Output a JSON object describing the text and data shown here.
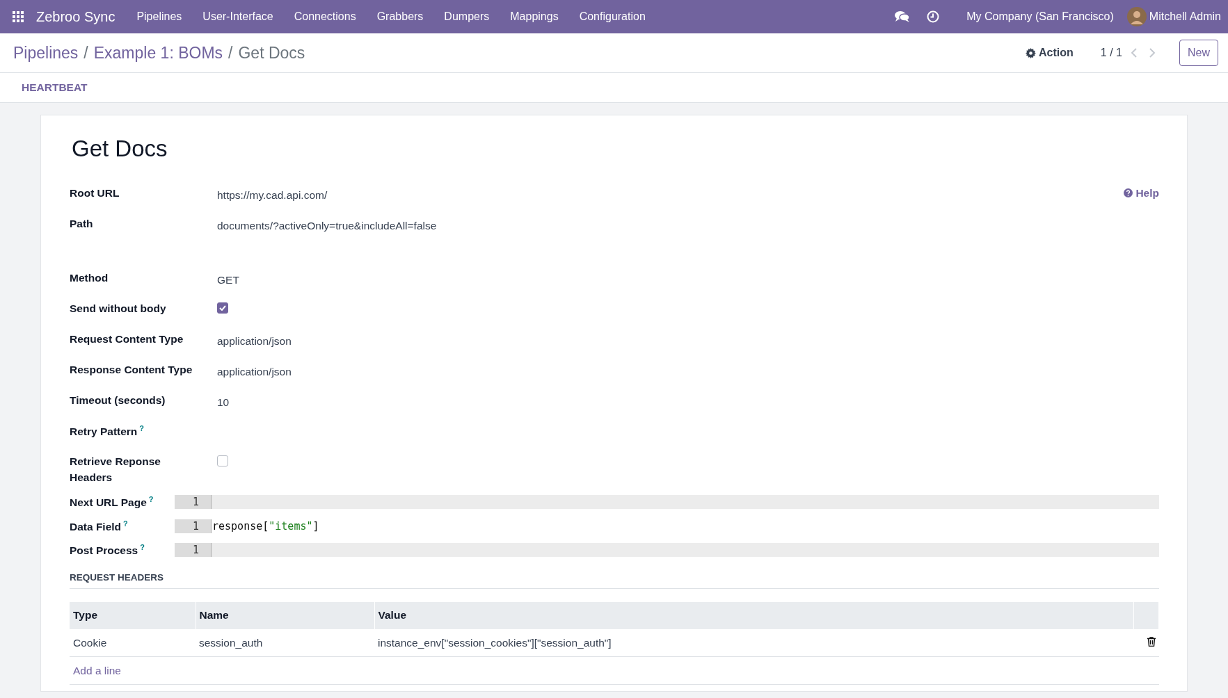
{
  "navbar": {
    "app_name": "Zebroo Sync",
    "menu": [
      "Pipelines",
      "User-Interface",
      "Connections",
      "Grabbers",
      "Dumpers",
      "Mappings",
      "Configuration"
    ],
    "company": "My Company (San Francisco)",
    "user": "Mitchell Admin"
  },
  "breadcrumb": [
    {
      "kind": "link",
      "label": "Pipelines"
    },
    {
      "kind": "separator",
      "label": "/"
    },
    {
      "kind": "link",
      "label": "Example 1: BOMs"
    },
    {
      "kind": "separator",
      "label": "/"
    },
    {
      "kind": "current",
      "label": "Get Docs"
    }
  ],
  "control_panel": {
    "action": "Action",
    "pager": "1 / 1",
    "new_button": "New"
  },
  "button_box": [
    "HEARTBEAT"
  ],
  "form": {
    "title": "Get Docs",
    "help": "Help",
    "fields": [
      {
        "label": "Root URL",
        "kind": "text",
        "value": "https://my.cad.api.com/"
      },
      {
        "label": "Path",
        "kind": "text",
        "value": "documents/?activeOnly=true&includeAll=false"
      },
      {
        "label": "Method",
        "kind": "text",
        "value": "GET"
      },
      {
        "label": "Send without body",
        "kind": "checkbox",
        "checked": true
      },
      {
        "label": "Request Content Type",
        "kind": "text",
        "value": "application/json"
      },
      {
        "label": "Response Content Type",
        "kind": "text",
        "value": "application/json"
      },
      {
        "label": "Timeout (seconds)",
        "kind": "text",
        "value": "10"
      },
      {
        "label": "Retry Pattern",
        "kind": "empty",
        "tooltip_mark": "?"
      },
      {
        "label": "Retrieve Reponse Headers",
        "kind": "checkbox",
        "checked": false
      },
      {
        "label": "Next URL Page",
        "kind": "code",
        "line_number": "1",
        "active": true,
        "tooltip_mark": "?"
      },
      {
        "label": "Data Field",
        "kind": "code",
        "line_number": "1",
        "active": false,
        "tokens": [
          {
            "text": "response[",
            "kind": "plain"
          },
          {
            "text": "\"items\"",
            "kind": "string"
          },
          {
            "text": "]",
            "kind": "plain"
          }
        ],
        "tooltip_mark": "?"
      },
      {
        "label": "Post Process",
        "kind": "code",
        "line_number": "1",
        "active": true,
        "tooltip_mark": "?"
      }
    ],
    "section_title": "REQUEST HEADERS",
    "table": {
      "columns": [
        "Type",
        "Name",
        "Value"
      ],
      "rows": [
        [
          "Cookie",
          "session_auth",
          "instance_env[\"session_cookies\"][\"session_auth\"]"
        ]
      ],
      "add_line": "Add a line"
    }
  }
}
